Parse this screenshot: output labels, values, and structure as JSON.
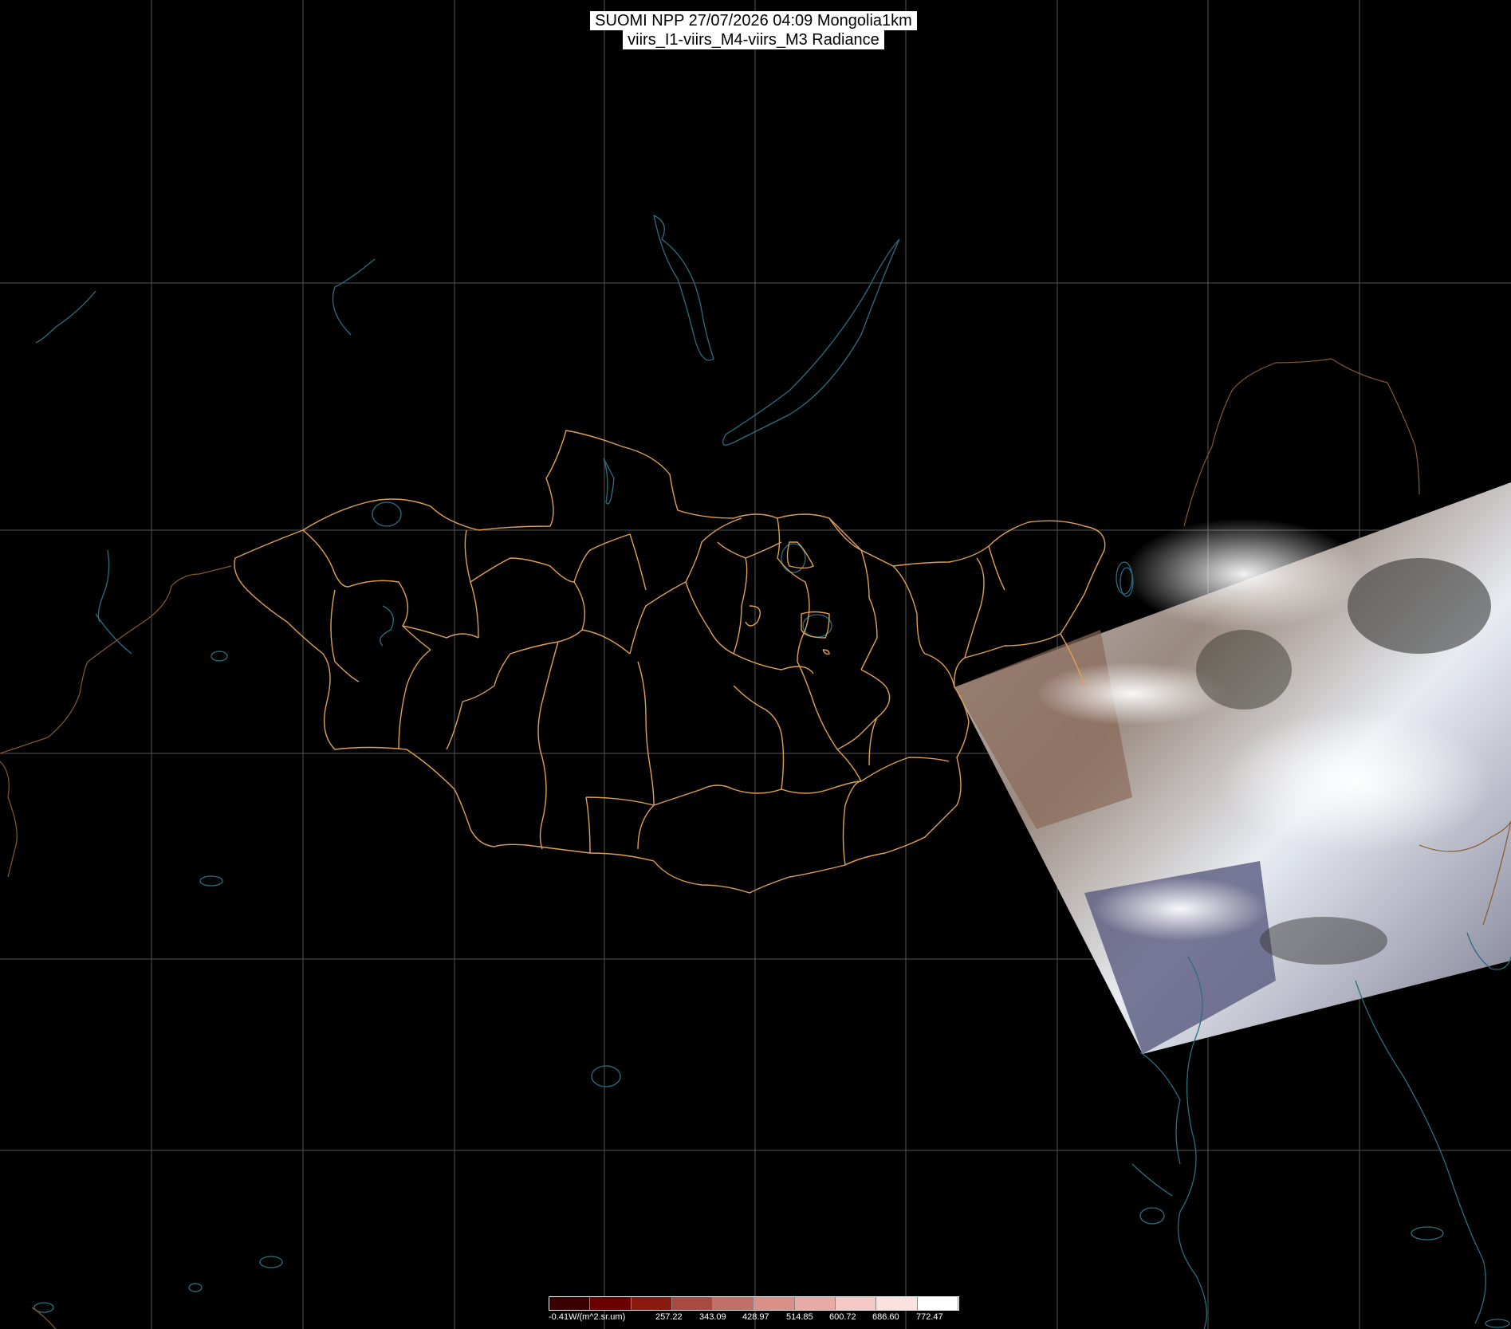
{
  "title": {
    "line1": "SUOMI NPP 27/07/2026 04:09 Mongolia1km",
    "line2": "viirs_I1-viirs_M4-viirs_M3 Radiance"
  },
  "colors": {
    "background": "#000000",
    "graticule": "#555555",
    "mongolia_borders": "#e0a050",
    "coastlines_rivers": "#2a6f80",
    "neighbor_borders": "#8a5a2a"
  },
  "legend": {
    "unit_label": "-0.41W/(m^2.sr.um)",
    "ticks": [
      "257.22",
      "343.09",
      "428.97",
      "514.85",
      "600.72",
      "686.60",
      "772.47"
    ],
    "swatches": [
      "#3a0000",
      "#6a0000",
      "#8a1a10",
      "#a84a40",
      "#c07068",
      "#d89088",
      "#e8aaa4",
      "#f4c8c4",
      "#fbe2e0",
      "#ffffff"
    ]
  }
}
